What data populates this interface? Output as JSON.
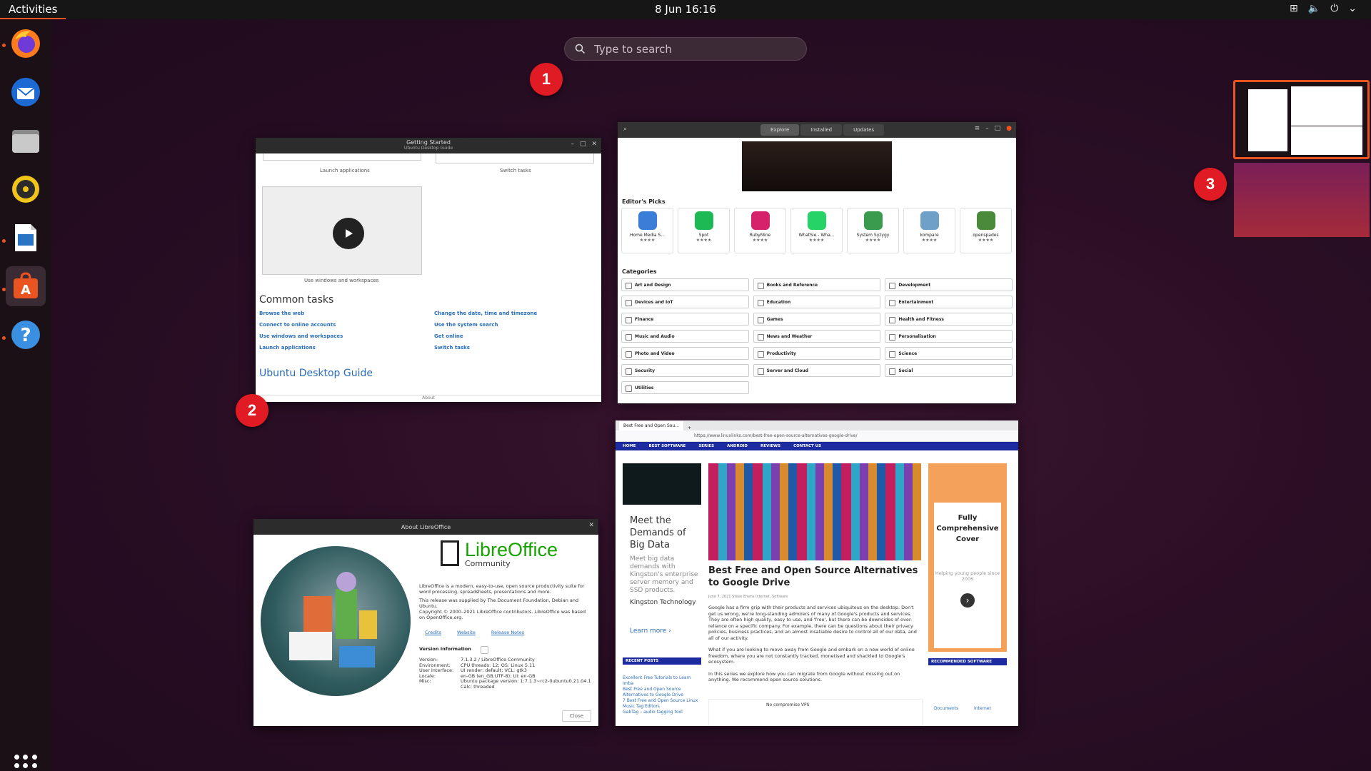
{
  "topbar": {
    "activities": "Activities",
    "clock": "8 Jun  16:16"
  },
  "search": {
    "placeholder": "Type to search"
  },
  "callouts": {
    "one": "1",
    "two": "2",
    "three": "3"
  },
  "getting_started": {
    "title": "Getting Started",
    "subtitle": "Ubuntu Desktop Guide",
    "thumb_launch": "Launch applications",
    "thumb_switch": "Switch tasks",
    "thumb_windows": "Use windows and workspaces",
    "common_tasks": "Common tasks",
    "links": [
      "Browse the web",
      "Change the date, time and timezone",
      "Connect to online accounts",
      "Use the system search",
      "Use windows and workspaces",
      "Get online",
      "Launch applications",
      "Switch tasks"
    ],
    "guide": "Ubuntu Desktop Guide",
    "about": "About"
  },
  "software": {
    "tabs": [
      "Explore",
      "Installed",
      "Updates"
    ],
    "editors_picks": "Editor's Picks",
    "picks": [
      {
        "name": "Home Media S...",
        "color": "#3b7ed8"
      },
      {
        "name": "Spot",
        "color": "#1db954"
      },
      {
        "name": "RubyMine",
        "color": "#d6226b"
      },
      {
        "name": "WhatSie - Wha...",
        "color": "#25d366"
      },
      {
        "name": "System Syzygy",
        "color": "#3a9a4d"
      },
      {
        "name": "kompare",
        "color": "#6fa0c8"
      },
      {
        "name": "openspades",
        "color": "#4a8a3a"
      }
    ],
    "stars": "★★★★",
    "categories_title": "Categories",
    "categories": [
      "Art and Design",
      "Books and Reference",
      "Development",
      "Devices and IoT",
      "Education",
      "Entertainment",
      "Finance",
      "Games",
      "Health and Fitness",
      "Music and Audio",
      "News and Weather",
      "Personalisation",
      "Photo and Video",
      "Productivity",
      "Science",
      "Security",
      "Server and Cloud",
      "Social",
      "Utilities"
    ]
  },
  "libreoffice": {
    "title": "About LibreOffice",
    "brand": "LibreOffice",
    "edition": "Community",
    "desc1": "LibreOffice is a modern, easy-to-use, open source productivity suite for word processing, spreadsheets, presentations and more.",
    "desc2": "This release was supplied by The Document Foundation, Debian and Ubuntu.",
    "desc3": "Copyright © 2000–2021 LibreOffice contributors. LibreOffice was based on OpenOffice.org.",
    "links": [
      "Credits",
      "Website",
      "Release Notes"
    ],
    "version_info": "Version Information",
    "rows": [
      [
        "Version:",
        "7.1.3.2 / LibreOffice Community"
      ],
      [
        "Environment:",
        "CPU threads: 12; OS: Linux 5.11"
      ],
      [
        "User Interface:",
        "UI render: default; VCL: gtk3"
      ],
      [
        "Locale:",
        "en-GB (en_GB.UTF-8); UI: en-GB"
      ],
      [
        "Misc:",
        "Ubuntu package version: 1:7.1.3~rc2-0ubuntu0.21.04.1"
      ],
      [
        "",
        "Calc: threaded"
      ]
    ],
    "close": "Close"
  },
  "browser": {
    "tab": "Best Free and Open Sou...",
    "url": "https://www.linuxlinks.com/best-free-open-source-alternatives-google-drive/",
    "nav": [
      "HOME",
      "BEST SOFTWARE",
      "SERIES",
      "ANDROID",
      "REVIEWS",
      "CONTACT US"
    ],
    "ad_heading": "Meet the Demands of Big Data",
    "ad_text": "Meet big data demands with Kingston's enterprise server memory and SSD products.",
    "ad_brand": "Kingston Technology",
    "ad_learn": "Learn more ›",
    "recent_posts": "RECENT POSTS",
    "recent_list": [
      "Excellent Free Tutorials to Learn Imba",
      "Best Free and Open Source Alternatives to Google Drive",
      "7 Best Free and Open Source Linux Music Tag Editors",
      "GabTag – audio tagging tool"
    ],
    "article_title": "Best Free and Open Source Alternatives to Google Drive",
    "article_meta": "June 7, 2021   Steve Emms   Internet, Software",
    "p1": "Google has a firm grip with their products and services ubiquitous on the desktop. Don't get us wrong, we're long-standing admirers of many of Google's products and services. They are often high quality, easy to use, and 'free', but there can be downsides of over-reliance on a specific company. For example, there can be questions about their privacy policies, business practices, and an almost insatiable desire to control all of our data, and all of our activity.",
    "p2": "What if you are looking to move away from Google and embark on a new world of online freedom, where you are not constantly tracked, monetised and shackled to Google's ecosystem.",
    "p3": "In this series we explore how you can migrate from Google without missing out on anything. We recommend open source solutions.",
    "ad2_heading": "Fully Comprehensive Cover",
    "ad2_text": "Helping young people since 2006",
    "recommended": "RECOMMENDED SOFTWARE",
    "rec_items": [
      "Documents",
      "Internet"
    ],
    "vps_ad": "No compromise VPS"
  }
}
